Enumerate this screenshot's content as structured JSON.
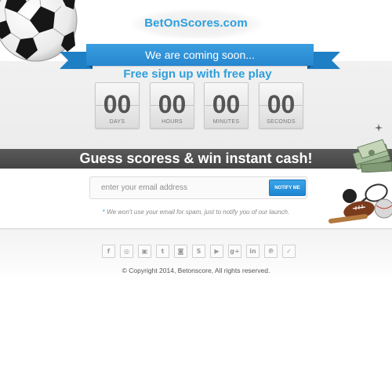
{
  "header": {
    "logo_text": "BetOnScores.com"
  },
  "hero": {
    "ribbon_text": "We are coming soon...",
    "signup_text": "Free sign up with  free play"
  },
  "countdown": [
    {
      "value": "00",
      "label": "DAYS"
    },
    {
      "value": "00",
      "label": "HOURS"
    },
    {
      "value": "00",
      "label": "MINUTES"
    },
    {
      "value": "00",
      "label": "SECONDS"
    }
  ],
  "banner": {
    "headline": "Guess scoress & win instant cash!"
  },
  "subscribe": {
    "placeholder": "enter your email address",
    "button_label": "NOTIFY ME",
    "note_star": "*",
    "note": "We won't use your email for spam, just to notify you of our launch."
  },
  "footer": {
    "social": [
      {
        "icon": "facebook-icon",
        "glyph": "f"
      },
      {
        "icon": "dribbble-icon",
        "glyph": "◎"
      },
      {
        "icon": "flickr-icon",
        "glyph": "▣"
      },
      {
        "icon": "tumblr-icon",
        "glyph": "t"
      },
      {
        "icon": "instagram-icon",
        "glyph": "◙"
      },
      {
        "icon": "skype-icon",
        "glyph": "S"
      },
      {
        "icon": "youtube-icon",
        "glyph": "▶"
      },
      {
        "icon": "google-plus-icon",
        "glyph": "g+"
      },
      {
        "icon": "linkedin-icon",
        "glyph": "in"
      },
      {
        "icon": "pinterest-icon",
        "glyph": "℗"
      },
      {
        "icon": "twitter-icon",
        "glyph": "✓"
      }
    ],
    "copyright": "© Copyright 2014, Betonscore, All rights reserved."
  },
  "colors": {
    "brand_blue": "#2d9fdc",
    "ribbon_blue": "#2786cf",
    "banner_dark": "#4a4a4a"
  }
}
